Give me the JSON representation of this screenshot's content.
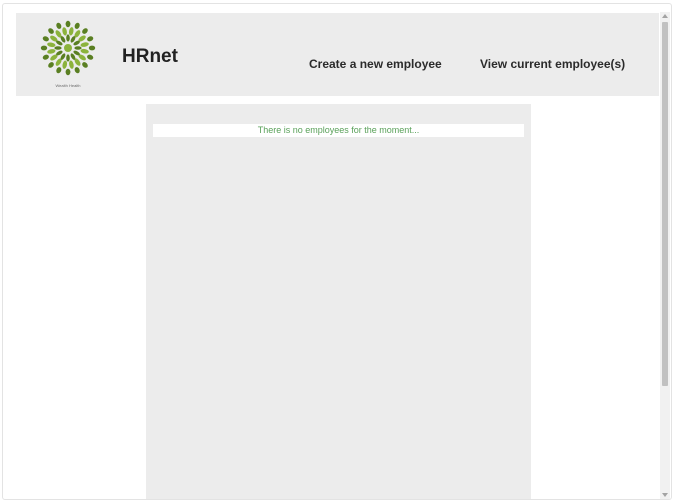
{
  "header": {
    "logo_icon": "green-leaf-wreath-logo-icon",
    "logo_tagline": "Wealth Health",
    "brand": "HRnet",
    "nav": {
      "create_label": "Create a new employee",
      "view_label": "View current employee(s)"
    }
  },
  "main": {
    "empty_message": "There is no employees for the moment..."
  },
  "colors": {
    "logo_green": "#8cb33c",
    "logo_dark_green": "#5a7f22",
    "message_green": "#5aa15a",
    "panel_gray": "#ececec"
  }
}
